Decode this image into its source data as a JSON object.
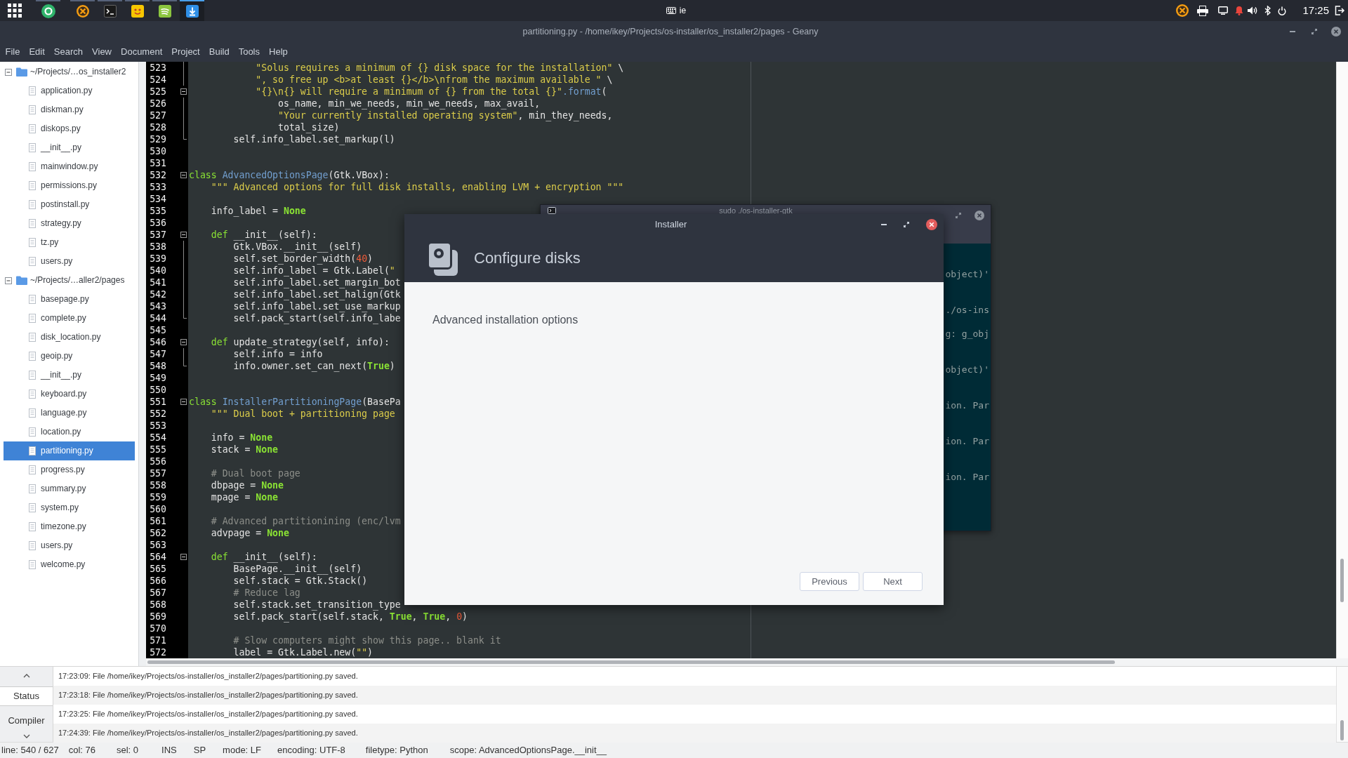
{
  "top_panel": {
    "keyboard_layout": "ie",
    "clock": "17:25"
  },
  "dock": [
    {
      "running": true,
      "active": false
    },
    {
      "running": true,
      "active": false
    },
    {
      "running": true,
      "active": false
    },
    {
      "running": true,
      "active": false
    },
    {
      "running": true,
      "active": false
    },
    {
      "running": true,
      "active": true
    }
  ],
  "window": {
    "title": "partitioning.py - /home/ikey/Projects/os-installer/os_installer2/pages - Geany"
  },
  "menu": [
    "File",
    "Edit",
    "Search",
    "View",
    "Document",
    "Project",
    "Build",
    "Tools",
    "Help"
  ],
  "sidebar": {
    "items": [
      {
        "kind": "folder",
        "label": "~/Projects/…os_installer2",
        "expanded": true,
        "selected": false,
        "children": [
          {
            "kind": "file",
            "label": "application.py",
            "selected": false
          },
          {
            "kind": "file",
            "label": "diskman.py",
            "selected": false
          },
          {
            "kind": "file",
            "label": "diskops.py",
            "selected": false
          },
          {
            "kind": "file",
            "label": "__init__.py",
            "selected": false
          },
          {
            "kind": "file",
            "label": "mainwindow.py",
            "selected": false
          },
          {
            "kind": "file",
            "label": "permissions.py",
            "selected": false
          },
          {
            "kind": "file",
            "label": "postinstall.py",
            "selected": false
          },
          {
            "kind": "file",
            "label": "strategy.py",
            "selected": false
          },
          {
            "kind": "file",
            "label": "tz.py",
            "selected": false
          },
          {
            "kind": "file",
            "label": "users.py",
            "selected": false
          }
        ]
      },
      {
        "kind": "folder",
        "label": "~/Projects/…aller2/pages",
        "expanded": true,
        "selected": false,
        "children": [
          {
            "kind": "file",
            "label": "basepage.py",
            "selected": false
          },
          {
            "kind": "file",
            "label": "complete.py",
            "selected": false
          },
          {
            "kind": "file",
            "label": "disk_location.py",
            "selected": false
          },
          {
            "kind": "file",
            "label": "geoip.py",
            "selected": false
          },
          {
            "kind": "file",
            "label": "__init__.py",
            "selected": false
          },
          {
            "kind": "file",
            "label": "keyboard.py",
            "selected": false
          },
          {
            "kind": "file",
            "label": "language.py",
            "selected": false
          },
          {
            "kind": "file",
            "label": "location.py",
            "selected": false
          },
          {
            "kind": "file",
            "label": "partitioning.py",
            "selected": true
          },
          {
            "kind": "file",
            "label": "progress.py",
            "selected": false
          },
          {
            "kind": "file",
            "label": "summary.py",
            "selected": false
          },
          {
            "kind": "file",
            "label": "system.py",
            "selected": false
          },
          {
            "kind": "file",
            "label": "timezone.py",
            "selected": false
          },
          {
            "kind": "file",
            "label": "users.py",
            "selected": false
          },
          {
            "kind": "file",
            "label": "welcome.py",
            "selected": false
          }
        ]
      }
    ]
  },
  "editor": {
    "lines": [
      {
        "number": "523",
        "tokens": [
          {
            "text": "            \"Solus requires a minimum of {} disk space for the installation\"",
            "kind": "string"
          },
          " \\"
        ]
      },
      {
        "number": "524",
        "tokens": [
          {
            "text": "            \", so free up <b>at least {}</b>\\nfrom the maximum available \"",
            "kind": "string"
          },
          " \\"
        ]
      },
      {
        "number": "525",
        "fold_start": true,
        "expanded": true,
        "tokens": [
          {
            "text": "            \"{}\\n{} will require a minimum of {} from the total {}\"",
            "kind": "string"
          },
          {
            "text": ".format",
            "kind": "method"
          },
          "("
        ]
      },
      {
        "number": "526",
        "tokens": [
          "                os_name, min_we_needs, min_we_needs, max_avail,"
        ]
      },
      {
        "number": "527",
        "tokens": [
          {
            "text": "                \"Your currently installed operating system\"",
            "kind": "string"
          },
          ", min_they_needs,"
        ]
      },
      {
        "number": "528",
        "tokens": [
          "                total_size)"
        ]
      },
      {
        "number": "529",
        "fold_end": true,
        "tokens": [
          "        self.info_label.set_markup(l)"
        ]
      },
      {
        "number": "530"
      },
      {
        "number": "531"
      },
      {
        "number": "532",
        "fold_start": true,
        "expanded": true,
        "tokens": [
          {
            "text": "class ",
            "kind": "keyword"
          },
          {
            "text": "AdvancedOptionsPage",
            "kind": "classname"
          },
          "(Gtk.VBox):"
        ]
      },
      {
        "number": "533",
        "tokens": [
          {
            "text": "    \"\"\" Advanced options for full disk installs, enabling LVM + encryption \"\"\"",
            "kind": "string"
          }
        ]
      },
      {
        "number": "534"
      },
      {
        "number": "535",
        "tokens": [
          "    info_label = ",
          {
            "text": "None",
            "kind": "constant"
          }
        ]
      },
      {
        "number": "536"
      },
      {
        "number": "537",
        "fold_start": true,
        "expanded": true,
        "tokens": [
          {
            "text": "    def",
            "kind": "keyword"
          },
          " __init__(self):"
        ]
      },
      {
        "number": "538",
        "tokens": [
          "        Gtk.VBox.__init__(self)"
        ]
      },
      {
        "number": "539",
        "tokens": [
          "        self.set_border_width(",
          {
            "text": "40",
            "kind": "number"
          },
          ")"
        ]
      },
      {
        "number": "540",
        "tokens": [
          "        self.info_label = Gtk.Label(",
          {
            "text": "\"",
            "kind": "string"
          }
        ]
      },
      {
        "number": "541",
        "tokens": [
          "        self.info_label.set_margin_bot"
        ]
      },
      {
        "number": "542",
        "tokens": [
          "        self.info_label.set_halign(Gtk"
        ]
      },
      {
        "number": "543",
        "tokens": [
          "        self.info_label.set_use_markup"
        ]
      },
      {
        "number": "544",
        "fold_end": true,
        "tokens": [
          "        self.pack_start(self.info_labe"
        ]
      },
      {
        "number": "545"
      },
      {
        "number": "546",
        "fold_start": true,
        "expanded": true,
        "tokens": [
          {
            "text": "    def",
            "kind": "keyword"
          },
          " update_strategy(self, info):"
        ]
      },
      {
        "number": "547",
        "tokens": [
          "        self.info = info"
        ]
      },
      {
        "number": "548",
        "fold_end": true,
        "tokens": [
          "        info.owner.set_can_next(",
          {
            "text": "True",
            "kind": "constant"
          },
          ")"
        ]
      },
      {
        "number": "549"
      },
      {
        "number": "550"
      },
      {
        "number": "551",
        "fold_start": true,
        "expanded": true,
        "tokens": [
          {
            "text": "class ",
            "kind": "keyword"
          },
          {
            "text": "InstallerPartitioningPage",
            "kind": "classname"
          },
          "(BasePa"
        ]
      },
      {
        "number": "552",
        "tokens": [
          {
            "text": "    \"\"\" Dual boot + partitioning page",
            "kind": "string"
          }
        ]
      },
      {
        "number": "553"
      },
      {
        "number": "554",
        "tokens": [
          "    info = ",
          {
            "text": "None",
            "kind": "constant"
          }
        ]
      },
      {
        "number": "555",
        "tokens": [
          "    stack = ",
          {
            "text": "None",
            "kind": "constant"
          }
        ]
      },
      {
        "number": "556"
      },
      {
        "number": "557",
        "tokens": [
          {
            "text": "    # Dual boot page",
            "kind": "comment"
          }
        ]
      },
      {
        "number": "558",
        "tokens": [
          "    dbpage = ",
          {
            "text": "None",
            "kind": "constant"
          }
        ]
      },
      {
        "number": "559",
        "tokens": [
          "    mpage = ",
          {
            "text": "None",
            "kind": "constant"
          }
        ]
      },
      {
        "number": "560"
      },
      {
        "number": "561",
        "tokens": [
          {
            "text": "    # Advanced partitionining (enc/lvm",
            "kind": "comment"
          }
        ]
      },
      {
        "number": "562",
        "tokens": [
          "    advpage = ",
          {
            "text": "None",
            "kind": "constant"
          }
        ]
      },
      {
        "number": "563"
      },
      {
        "number": "564",
        "fold_start": true,
        "expanded": true,
        "tokens": [
          {
            "text": "    def",
            "kind": "keyword"
          },
          " __init__(self):"
        ]
      },
      {
        "number": "565",
        "tokens": [
          "        BasePage.__init__(self)"
        ]
      },
      {
        "number": "566",
        "tokens": [
          "        self.stack = Gtk.Stack()"
        ]
      },
      {
        "number": "567",
        "tokens": [
          {
            "text": "        # Reduce lag",
            "kind": "comment"
          }
        ]
      },
      {
        "number": "568",
        "tokens": [
          "        self.stack.set_transition_type"
        ]
      },
      {
        "number": "569",
        "tokens": [
          "        self.pack_start(self.stack, ",
          {
            "text": "True",
            "kind": "constant"
          },
          ", ",
          {
            "text": "True",
            "kind": "constant"
          },
          ", ",
          {
            "text": "0",
            "kind": "number"
          },
          ")"
        ]
      },
      {
        "number": "570"
      },
      {
        "number": "571",
        "tokens": [
          {
            "text": "        # Slow computers might show this page.. blank it",
            "kind": "comment"
          }
        ]
      },
      {
        "number": "572",
        "tokens": [
          "        label = Gtk.Label.new(",
          {
            "text": "\"\"",
            "kind": "string"
          },
          ")"
        ]
      }
    ]
  },
  "messages": {
    "tabs": [
      {
        "label": "Status",
        "selected": true
      },
      {
        "label": "Compiler",
        "selected": false
      }
    ],
    "rows": [
      "17:23:09: File /home/ikey/Projects/os-installer/os_installer2/pages/partitioning.py saved.",
      "17:23:18: File /home/ikey/Projects/os-installer/os_installer2/pages/partitioning.py saved.",
      "17:23:25: File /home/ikey/Projects/os-installer/os_installer2/pages/partitioning.py saved.",
      "17:24:39: File /home/ikey/Projects/os-installer/os_installer2/pages/partitioning.py saved."
    ]
  },
  "status_bar": [
    "line: 540 / 627",
    "col: 76",
    "sel: 0",
    "INS",
    "SP",
    "mode: LF",
    "encoding: UTF-8",
    "filetype: Python",
    "scope: AdvancedOptionsPage.__init__"
  ],
  "terminal": {
    "title": "sudo ./os-installer-gtk",
    "lines": [
      "object)'",
      "./os-ins",
      "g: g_obj",
      "object)'",
      "ion. Par",
      "ion. Par",
      "ion. Par"
    ]
  },
  "dialog": {
    "title": "Installer",
    "heading": "Configure disks",
    "text": "Advanced installation options",
    "buttons": [
      "Previous",
      "Next"
    ]
  }
}
